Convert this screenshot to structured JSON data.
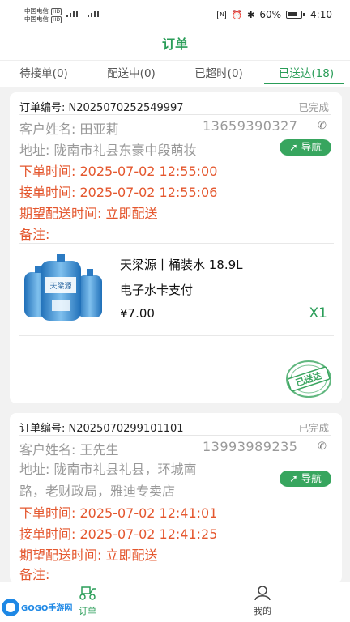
{
  "statusbar": {
    "carrier1": "中国电信",
    "carrier2": "中国电信",
    "hd": "HD",
    "net": "4G",
    "battery": "60%",
    "time": "4:10"
  },
  "header": {
    "title": "订单"
  },
  "tabs": [
    {
      "label": "待接单(0)"
    },
    {
      "label": "配送中(0)"
    },
    {
      "label": "已超时(0)"
    },
    {
      "label": "已送达(18)"
    }
  ],
  "orders": [
    {
      "order_no": "订单编号:  N2025070252549997",
      "status": "已完成",
      "customer": "客户姓名:  田亚莉",
      "phone": "13659390327",
      "address": "地址:  陇南市礼县东豪中段萌妆",
      "nav_label": "导航",
      "order_time": "下单时间:  2025-07-02 12:55:00",
      "accept_time": "接单时间:  2025-07-02 12:55:06",
      "expected_time": "期望配送时间:  立即配送",
      "remark": "备注:",
      "product": {
        "name": "天梁源丨桶装水 18.9L",
        "payment": "电子水卡支付",
        "price": "¥7.00",
        "qty": "X1",
        "img_brand": "天梁源"
      },
      "stamp": "已送达"
    },
    {
      "order_no": "订单编号:  N2025070299101101",
      "status": "已完成",
      "customer": "客户姓名:  王先生",
      "phone": "13993989235",
      "address_line1": "地址:  陇南市礼县礼县，环城南",
      "address_line2": "路，老财政局，雅迪专卖店",
      "nav_label": "导航",
      "order_time": "下单时间:  2025-07-02 12:41:01",
      "accept_time": "接单时间:  2025-07-02 12:41:25",
      "expected_time": "期望配送时间:  立即配送",
      "remark": "备注:"
    }
  ],
  "bottom_nav": [
    {
      "label": "订单"
    },
    {
      "label": "我的"
    }
  ],
  "watermark": "GOGO手游网",
  "colors": {
    "accent": "#2a9d58",
    "nav_button": "#37a55e",
    "time_red": "#e4572e",
    "muted": "#999999"
  }
}
